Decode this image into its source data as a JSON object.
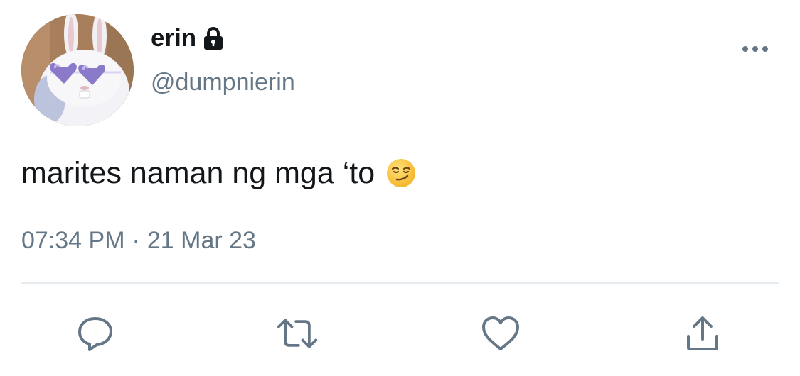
{
  "user": {
    "display_name": "erin",
    "handle": "@dumpnierin",
    "protected": true,
    "avatar_icon": "bunny-with-heart-sunglasses"
  },
  "tweet": {
    "text": "marites naman ng mga ‘to",
    "emoji": "smirking-face"
  },
  "meta": {
    "time": "07:34 PM",
    "separator": "·",
    "date": "21 Mar 23"
  },
  "actions": [
    {
      "name": "reply",
      "icon": "reply-icon"
    },
    {
      "name": "retweet",
      "icon": "retweet-icon"
    },
    {
      "name": "like",
      "icon": "heart-icon"
    },
    {
      "name": "share",
      "icon": "share-icon"
    }
  ],
  "colors": {
    "text_primary": "#14171a",
    "text_secondary": "#657786",
    "icon": "#657786",
    "divider": "#e6ecf0"
  }
}
